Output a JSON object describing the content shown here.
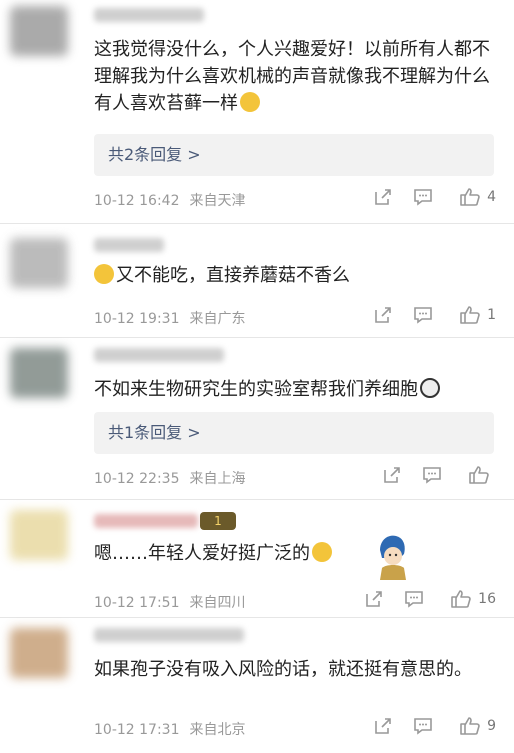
{
  "comments": [
    {
      "text": "这我觉得没什么，个人兴趣爱好！以前所有人都不理解我为什么喜欢机械的声音就像我不理解为什么有人喜欢苔藓一样",
      "emoji": "laughing-tears-emoji",
      "replies_label": "共2条回复 >",
      "date": "10-12 16:42",
      "location": "来自天津",
      "likes": "4",
      "avatar_color": "#9c9c9c"
    },
    {
      "text": "又不能吃，直接养蘑菇不香么",
      "emoji": "laughing-tears-emoji",
      "date": "10-12 19:31",
      "location": "来自广东",
      "likes": "1",
      "avatar_color": "#b0b0b0"
    },
    {
      "text": "不如来生物研究生的实验室帮我们养细胞",
      "emoji": "panda-emoji",
      "replies_label": "共1条回复 >",
      "date": "10-12 22:35",
      "location": "来自上海",
      "likes": "",
      "avatar_color": "#7f8a86"
    },
    {
      "text": "嗯……年轻人爱好挺广泛的",
      "emoji": "gift-face-emoji",
      "badge_label": "1",
      "date": "10-12 17:51",
      "location": "来自四川",
      "likes": "16",
      "avatar_color": "#e8d9a0"
    },
    {
      "text": "如果孢子没有吸入风险的话，就还挺有意思的。",
      "date": "10-12 17:31",
      "location": "来自北京",
      "likes": "9",
      "avatar_color": "#c7a078"
    }
  ]
}
